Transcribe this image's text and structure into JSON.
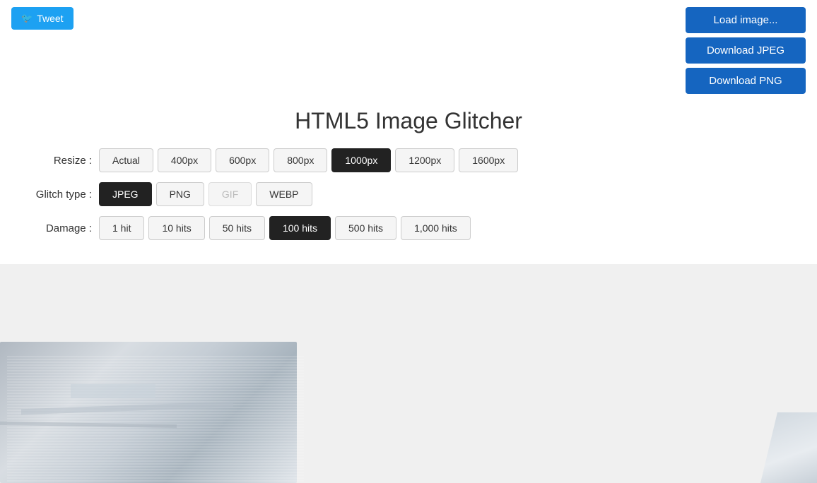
{
  "app": {
    "title": "HTML5 Image Glitcher"
  },
  "twitter": {
    "button_label": "Tweet"
  },
  "buttons": {
    "load_image": "Load image...",
    "download_jpeg": "Download JPEG",
    "download_png": "Download PNG"
  },
  "resize": {
    "label": "Resize :",
    "options": [
      {
        "label": "Actual",
        "active": false
      },
      {
        "label": "400px",
        "active": false
      },
      {
        "label": "600px",
        "active": false
      },
      {
        "label": "800px",
        "active": false
      },
      {
        "label": "1000px",
        "active": true
      },
      {
        "label": "1200px",
        "active": false
      },
      {
        "label": "1600px",
        "active": false
      }
    ]
  },
  "glitch_type": {
    "label": "Glitch type :",
    "options": [
      {
        "label": "JPEG",
        "active": true,
        "disabled": false
      },
      {
        "label": "PNG",
        "active": false,
        "disabled": false
      },
      {
        "label": "GIF",
        "active": false,
        "disabled": true
      },
      {
        "label": "WEBP",
        "active": false,
        "disabled": false
      }
    ]
  },
  "damage": {
    "label": "Damage :",
    "options": [
      {
        "label": "1 hit",
        "active": false
      },
      {
        "label": "10 hits",
        "active": false
      },
      {
        "label": "50 hits",
        "active": false
      },
      {
        "label": "100 hits",
        "active": true
      },
      {
        "label": "500 hits",
        "active": false
      },
      {
        "label": "1,000 hits",
        "active": false
      }
    ]
  }
}
